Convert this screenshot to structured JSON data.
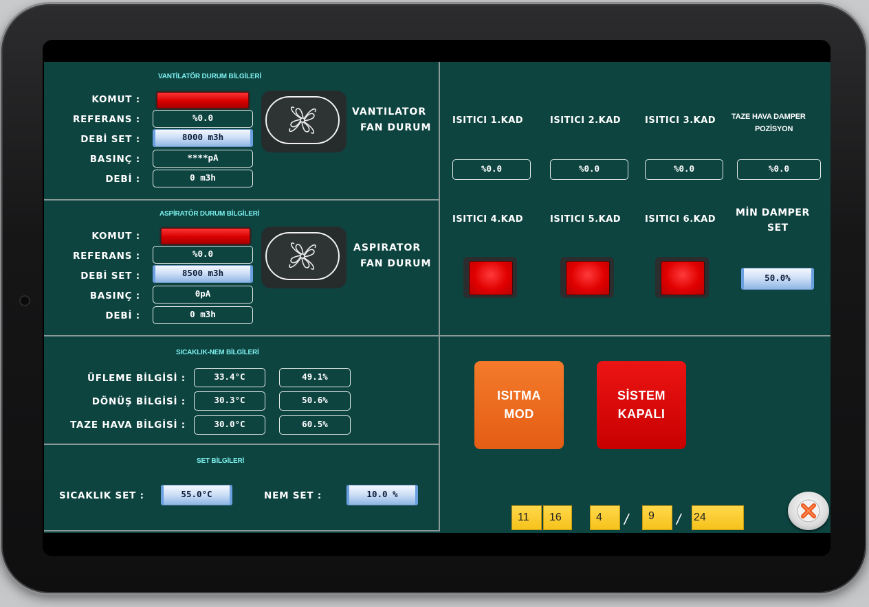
{
  "vantilator": {
    "title": "VANTİLATÖR DURUM BİLGİLERİ",
    "labels": [
      "KOMUT :",
      "REFERANS :",
      "DEBİ SET :",
      "BASINÇ :",
      "DEBİ :"
    ],
    "referans": "%0.0",
    "debi_set": "8000 m3h",
    "basinc": "****pA",
    "debi": "0 m3h",
    "fan_label_1": "VANTILATOR",
    "fan_label_2": "FAN DURUM"
  },
  "aspirator": {
    "title": "ASPİRATÖR DURUM BİLGİLERİ",
    "labels": [
      "KOMUT :",
      "REFERANS :",
      "DEBİ SET :",
      "BASINÇ :",
      "DEBİ :"
    ],
    "referans": "%0.0",
    "debi_set": "8500 m3h",
    "basinc": "0pA",
    "debi": "0 m3h",
    "fan_label_1": "ASPIRATOR",
    "fan_label_2": "FAN DURUM"
  },
  "sicaklik_nem": {
    "title": "SICAKLIK-NEM BİLGİLERİ",
    "rows": [
      {
        "label": "ÜFLEME BİLGİSİ :",
        "temp": "33.4°C",
        "hum": "49.1%"
      },
      {
        "label": "DÖNÜŞ BİLGİSİ :",
        "temp": "30.3°C",
        "hum": "50.6%"
      },
      {
        "label": "TAZE HAVA BİLGİSİ :",
        "temp": "30.0°C",
        "hum": "60.5%"
      }
    ]
  },
  "set": {
    "title": "SET BİLGİLERİ",
    "sicaklik_label": "SICAKLIK SET  :",
    "sicaklik_value": "55.0°C",
    "nem_label": "NEM SET  :",
    "nem_value": "10.0 %"
  },
  "heaters": {
    "top": [
      {
        "label": "ISITICI 1.KAD",
        "value": "%0.0"
      },
      {
        "label": "ISITICI 2.KAD",
        "value": "%0.0"
      },
      {
        "label": "ISITICI 3.KAD",
        "value": "%0.0"
      }
    ],
    "damper_label_1": "TAZE HAVA DAMPER",
    "damper_label_2": "POZİSYON",
    "damper_value": "%0.0",
    "bottom": [
      "ISITICI 4.KAD",
      "ISITICI 5.KAD",
      "ISITICI 6.KAD"
    ],
    "min_damper_label_1": "MİN DAMPER",
    "min_damper_label_2": "SET",
    "min_damper_value": "50.0%"
  },
  "modes": {
    "isitma": "ISITMA\nMOD",
    "sistem": "SİSTEM\nKAPALI"
  },
  "datetime": {
    "hour": "11",
    "minute": "16",
    "day": "4",
    "month": "9",
    "year": "24",
    "sep": "/"
  },
  "colors": {
    "panel_bg": "#0d4440",
    "title_cyan": "#7ef0ee",
    "isitma_orange": "#ef6a1c",
    "sistem_red": "#d90808",
    "heater_red": "#e00000"
  },
  "icons": {
    "fan": "fan-icon",
    "close": "close-icon"
  }
}
